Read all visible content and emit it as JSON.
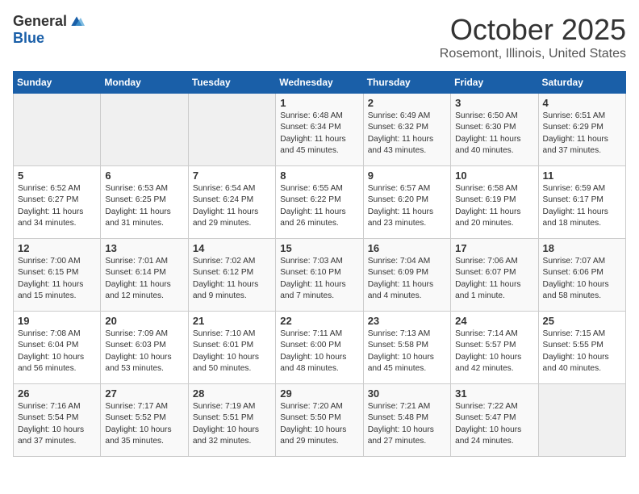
{
  "logo": {
    "general": "General",
    "blue": "Blue"
  },
  "title": "October 2025",
  "location": "Rosemont, Illinois, United States",
  "days_of_week": [
    "Sunday",
    "Monday",
    "Tuesday",
    "Wednesday",
    "Thursday",
    "Friday",
    "Saturday"
  ],
  "weeks": [
    [
      {
        "num": "",
        "info": ""
      },
      {
        "num": "",
        "info": ""
      },
      {
        "num": "",
        "info": ""
      },
      {
        "num": "1",
        "info": "Sunrise: 6:48 AM\nSunset: 6:34 PM\nDaylight: 11 hours and 45 minutes."
      },
      {
        "num": "2",
        "info": "Sunrise: 6:49 AM\nSunset: 6:32 PM\nDaylight: 11 hours and 43 minutes."
      },
      {
        "num": "3",
        "info": "Sunrise: 6:50 AM\nSunset: 6:30 PM\nDaylight: 11 hours and 40 minutes."
      },
      {
        "num": "4",
        "info": "Sunrise: 6:51 AM\nSunset: 6:29 PM\nDaylight: 11 hours and 37 minutes."
      }
    ],
    [
      {
        "num": "5",
        "info": "Sunrise: 6:52 AM\nSunset: 6:27 PM\nDaylight: 11 hours and 34 minutes."
      },
      {
        "num": "6",
        "info": "Sunrise: 6:53 AM\nSunset: 6:25 PM\nDaylight: 11 hours and 31 minutes."
      },
      {
        "num": "7",
        "info": "Sunrise: 6:54 AM\nSunset: 6:24 PM\nDaylight: 11 hours and 29 minutes."
      },
      {
        "num": "8",
        "info": "Sunrise: 6:55 AM\nSunset: 6:22 PM\nDaylight: 11 hours and 26 minutes."
      },
      {
        "num": "9",
        "info": "Sunrise: 6:57 AM\nSunset: 6:20 PM\nDaylight: 11 hours and 23 minutes."
      },
      {
        "num": "10",
        "info": "Sunrise: 6:58 AM\nSunset: 6:19 PM\nDaylight: 11 hours and 20 minutes."
      },
      {
        "num": "11",
        "info": "Sunrise: 6:59 AM\nSunset: 6:17 PM\nDaylight: 11 hours and 18 minutes."
      }
    ],
    [
      {
        "num": "12",
        "info": "Sunrise: 7:00 AM\nSunset: 6:15 PM\nDaylight: 11 hours and 15 minutes."
      },
      {
        "num": "13",
        "info": "Sunrise: 7:01 AM\nSunset: 6:14 PM\nDaylight: 11 hours and 12 minutes."
      },
      {
        "num": "14",
        "info": "Sunrise: 7:02 AM\nSunset: 6:12 PM\nDaylight: 11 hours and 9 minutes."
      },
      {
        "num": "15",
        "info": "Sunrise: 7:03 AM\nSunset: 6:10 PM\nDaylight: 11 hours and 7 minutes."
      },
      {
        "num": "16",
        "info": "Sunrise: 7:04 AM\nSunset: 6:09 PM\nDaylight: 11 hours and 4 minutes."
      },
      {
        "num": "17",
        "info": "Sunrise: 7:06 AM\nSunset: 6:07 PM\nDaylight: 11 hours and 1 minute."
      },
      {
        "num": "18",
        "info": "Sunrise: 7:07 AM\nSunset: 6:06 PM\nDaylight: 10 hours and 58 minutes."
      }
    ],
    [
      {
        "num": "19",
        "info": "Sunrise: 7:08 AM\nSunset: 6:04 PM\nDaylight: 10 hours and 56 minutes."
      },
      {
        "num": "20",
        "info": "Sunrise: 7:09 AM\nSunset: 6:03 PM\nDaylight: 10 hours and 53 minutes."
      },
      {
        "num": "21",
        "info": "Sunrise: 7:10 AM\nSunset: 6:01 PM\nDaylight: 10 hours and 50 minutes."
      },
      {
        "num": "22",
        "info": "Sunrise: 7:11 AM\nSunset: 6:00 PM\nDaylight: 10 hours and 48 minutes."
      },
      {
        "num": "23",
        "info": "Sunrise: 7:13 AM\nSunset: 5:58 PM\nDaylight: 10 hours and 45 minutes."
      },
      {
        "num": "24",
        "info": "Sunrise: 7:14 AM\nSunset: 5:57 PM\nDaylight: 10 hours and 42 minutes."
      },
      {
        "num": "25",
        "info": "Sunrise: 7:15 AM\nSunset: 5:55 PM\nDaylight: 10 hours and 40 minutes."
      }
    ],
    [
      {
        "num": "26",
        "info": "Sunrise: 7:16 AM\nSunset: 5:54 PM\nDaylight: 10 hours and 37 minutes."
      },
      {
        "num": "27",
        "info": "Sunrise: 7:17 AM\nSunset: 5:52 PM\nDaylight: 10 hours and 35 minutes."
      },
      {
        "num": "28",
        "info": "Sunrise: 7:19 AM\nSunset: 5:51 PM\nDaylight: 10 hours and 32 minutes."
      },
      {
        "num": "29",
        "info": "Sunrise: 7:20 AM\nSunset: 5:50 PM\nDaylight: 10 hours and 29 minutes."
      },
      {
        "num": "30",
        "info": "Sunrise: 7:21 AM\nSunset: 5:48 PM\nDaylight: 10 hours and 27 minutes."
      },
      {
        "num": "31",
        "info": "Sunrise: 7:22 AM\nSunset: 5:47 PM\nDaylight: 10 hours and 24 minutes."
      },
      {
        "num": "",
        "info": ""
      }
    ]
  ]
}
